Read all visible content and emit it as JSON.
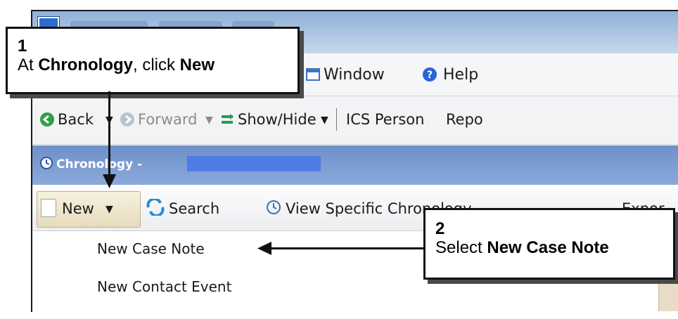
{
  "window": {
    "title_obscured": true
  },
  "menu": {
    "window_label": "Window",
    "help_label": "Help"
  },
  "nav": {
    "back_label": "Back",
    "forward_label": "Forward",
    "showhide_label": "Show/Hide",
    "person_label": "ICS Person",
    "reports_label": "Repo"
  },
  "panel": {
    "title": "Chronology -"
  },
  "toolbar": {
    "new_label": "New",
    "search_label": "Search",
    "view_label": "View Specific Chronology",
    "export_label": "Expor"
  },
  "dropdown": {
    "items": [
      "New Case Note",
      "New Contact Event"
    ]
  },
  "callout1": {
    "number": "1",
    "text_prefix": "At ",
    "text_bold1": "Chronology",
    "text_middle": ", click ",
    "text_bold2": "New"
  },
  "callout2": {
    "number": "2",
    "text_prefix": "Select ",
    "text_bold": "New Case Note"
  },
  "colors": {
    "panel_header": "#6d90c9",
    "help_icon": "#2a63d8",
    "back_icon": "#2fa04a",
    "showhide_icon": "#1ea052"
  }
}
